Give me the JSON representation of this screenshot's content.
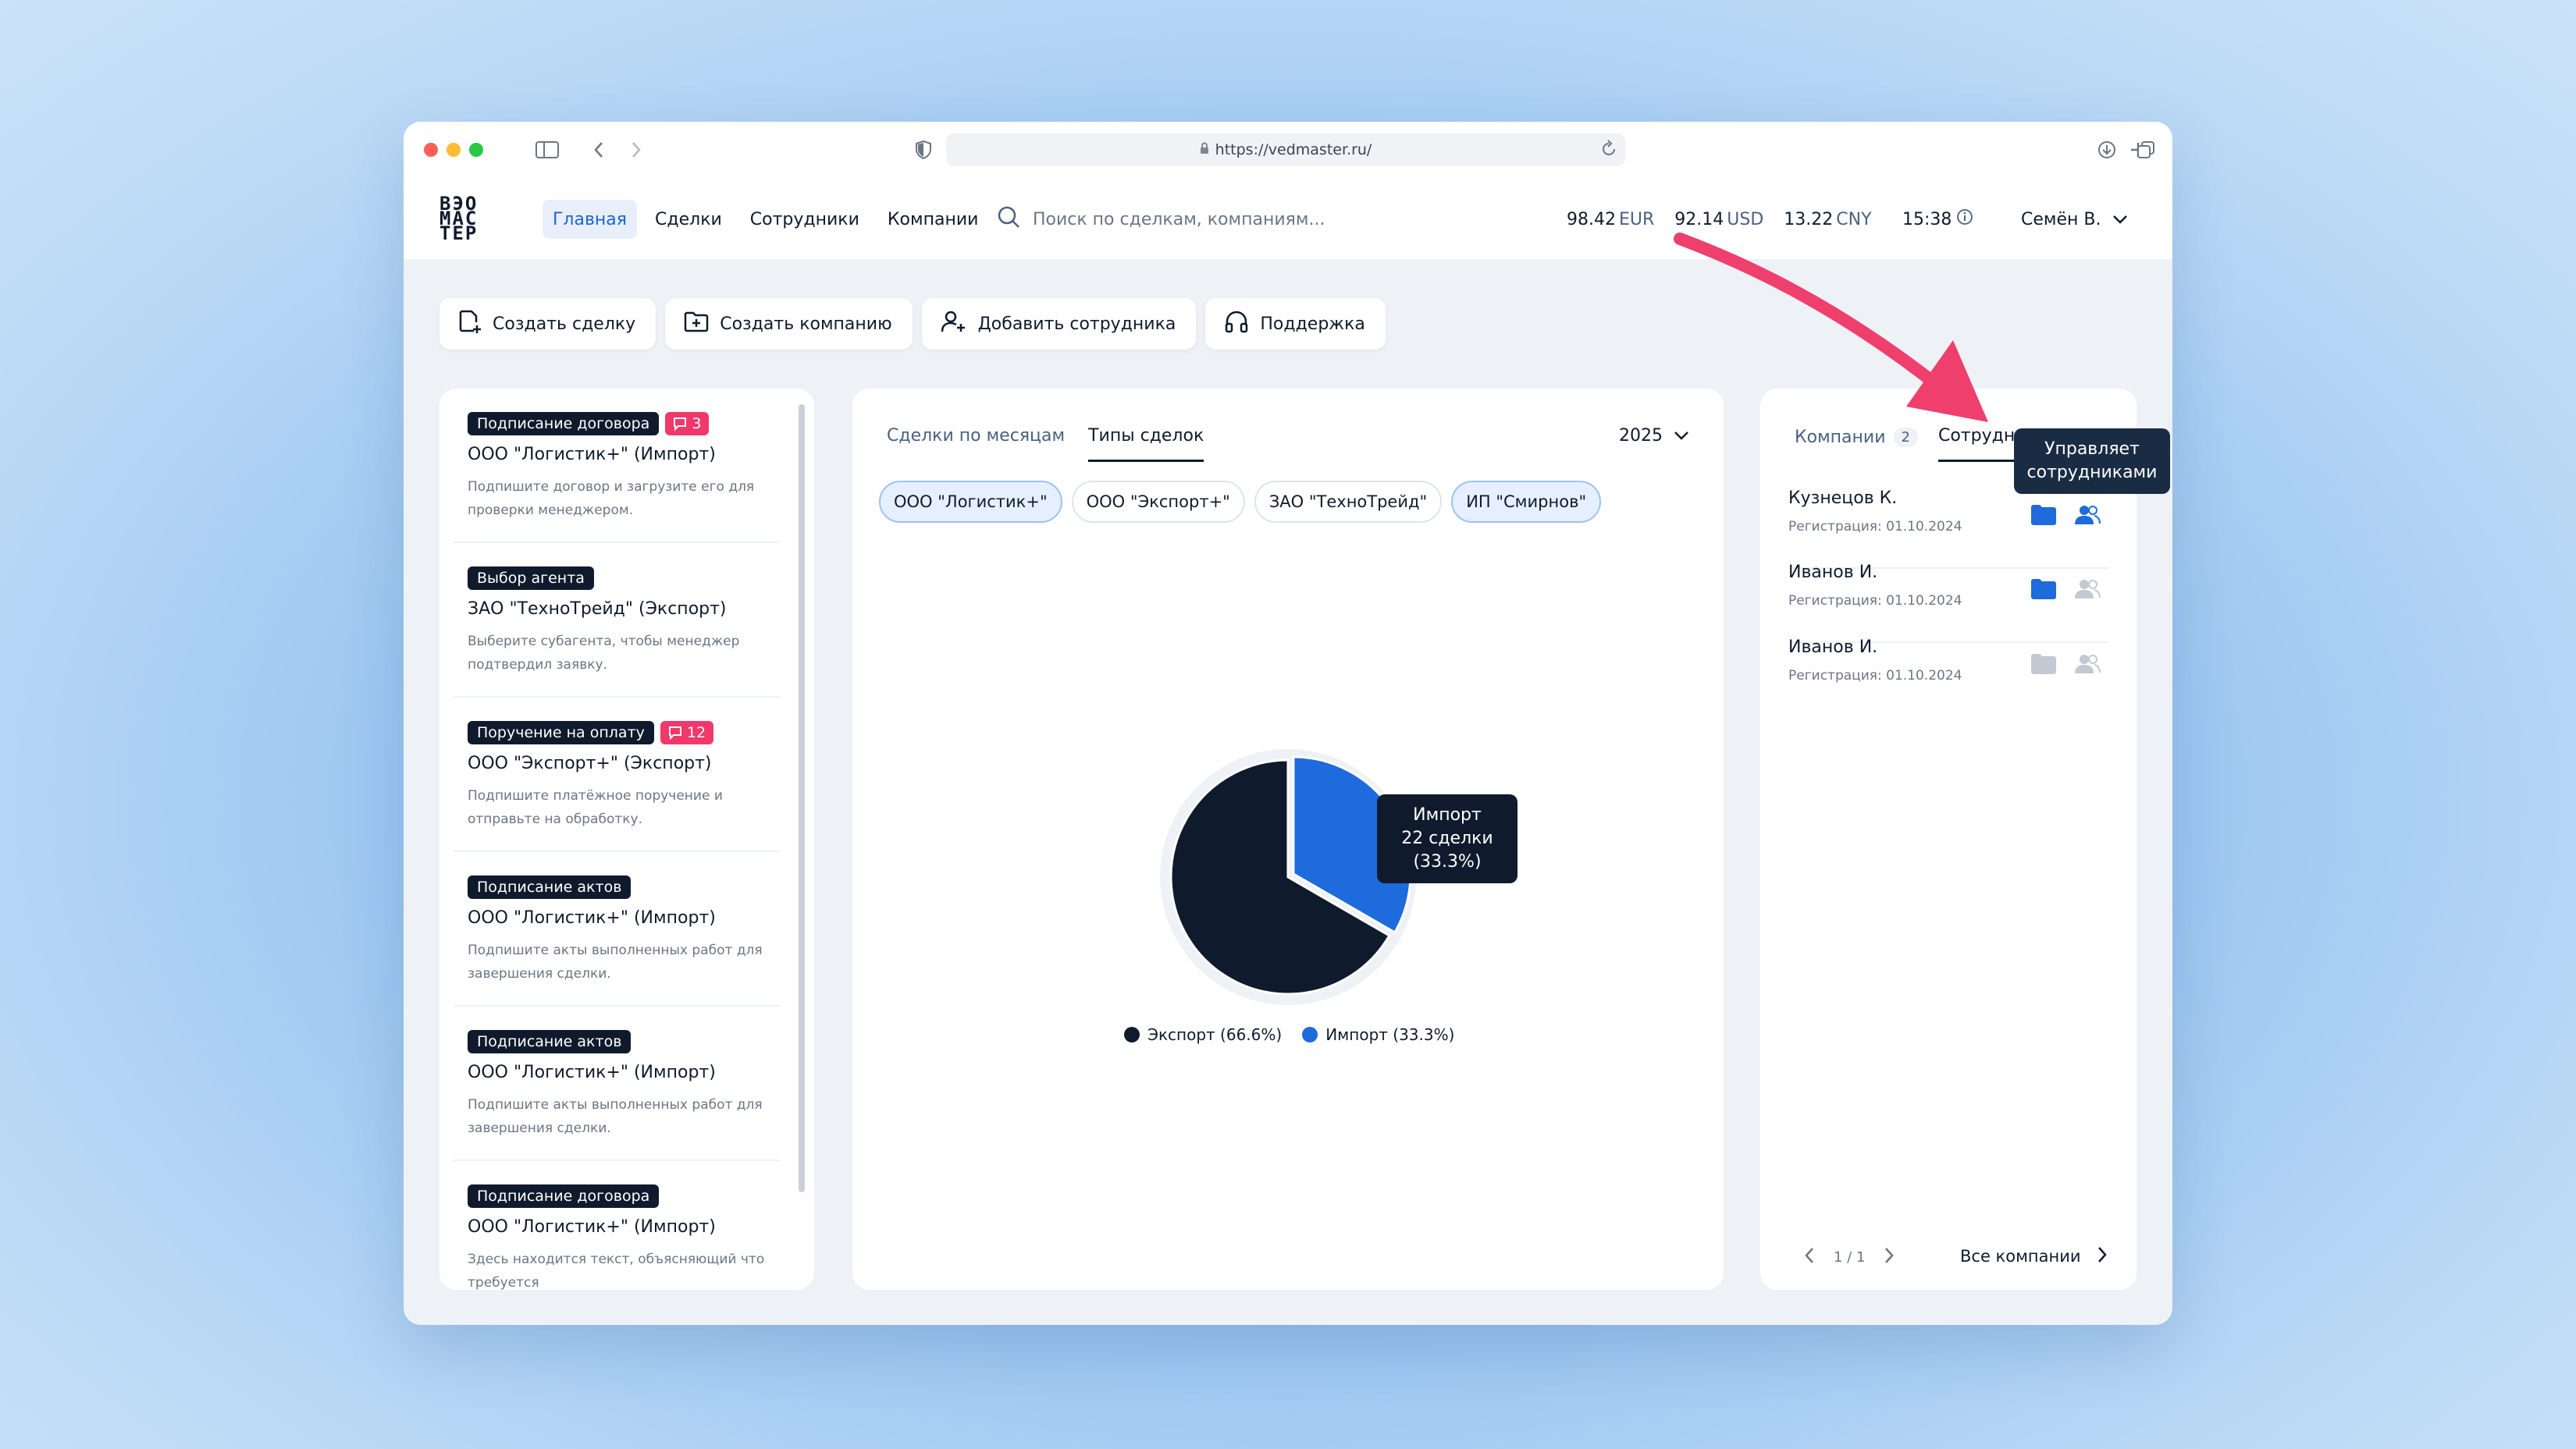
{
  "browser": {
    "url": "https://vedmaster.ru/"
  },
  "logo": {
    "line1": "ВЭО",
    "line2": "МАС",
    "line3": "ТЕР"
  },
  "nav": [
    "Главная",
    "Сделки",
    "Сотрудники",
    "Компании"
  ],
  "search": {
    "placeholder": "Поиск по сделкам, компаниям..."
  },
  "rates": [
    {
      "value": "98.42",
      "currency": "EUR"
    },
    {
      "value": "92.14",
      "currency": "USD"
    },
    {
      "value": "13.22",
      "currency": "CNY"
    }
  ],
  "clock": "15:38",
  "user": "Семён В.",
  "actions": [
    "Создать сделку",
    "Создать компанию",
    "Добавить сотрудника",
    "Поддержка"
  ],
  "tasks": [
    {
      "tag": "Подписание договора",
      "count": "3",
      "title": "ООО \"Логистик+\" (Импорт)",
      "desc": "Подпишите договор и загрузите его для проверки менеджером."
    },
    {
      "tag": "Выбор агента",
      "count": "",
      "title": "ЗАО \"ТехноТрейд\" (Экспорт)",
      "desc": "Выберите субагента, чтобы менеджер подтвердил заявку."
    },
    {
      "tag": "Поручение на оплату",
      "count": "12",
      "title": "ООО \"Экспорт+\" (Экспорт)",
      "desc": "Подпишите платёжное поручение и отправьте на обработку."
    },
    {
      "tag": "Подписание актов",
      "count": "",
      "title": "ООО \"Логистик+\" (Импорт)",
      "desc": "Подпишите акты выполненных работ для завершения сделки."
    },
    {
      "tag": "Подписание актов",
      "count": "",
      "title": "ООО \"Логистик+\" (Импорт)",
      "desc": "Подпишите акты выполненных работ для завершения сделки."
    },
    {
      "tag": "Подписание договора",
      "count": "",
      "title": "ООО \"Логистик+\" (Импорт)",
      "desc": "Здесь находится текст, объясняющий что требуется"
    }
  ],
  "chart_panel": {
    "tabs": [
      "Сделки по месяцам",
      "Типы сделок"
    ],
    "year": "2025",
    "chips": [
      "ООО \"Логистик+\"",
      "ООО \"Экспорт+\"",
      "ЗАО \"ТехноТрейд\"",
      "ИП \"Смирнов\""
    ],
    "tooltip": {
      "line1": "Импорт",
      "line2": "22 сделки",
      "line3": "(33.3%)"
    }
  },
  "chart_data": {
    "type": "pie",
    "categories": [
      "Экспорт",
      "Импорт"
    ],
    "values": [
      66.6,
      33.3
    ],
    "colors": [
      "#0f1b2d",
      "#1d6bdc"
    ],
    "legend": [
      "Экспорт (66.6%)",
      "Импорт (33.3%)"
    ],
    "highlighted": "Импорт"
  },
  "right_panel": {
    "tabs": [
      {
        "label": "Компании",
        "badge": "2"
      },
      {
        "label": "Сотрудни",
        "badge": ""
      }
    ],
    "tooltip": {
      "line1": "Управляет",
      "line2": "сотрудниками"
    },
    "employees": [
      {
        "name": "Кузнецов К.",
        "reg": "Регистрация: 01.10.2024",
        "folder": "active",
        "people": "active"
      },
      {
        "name": "Иванов И.",
        "reg": "Регистрация: 01.10.2024",
        "folder": "active",
        "people": "inactive"
      },
      {
        "name": "Иванов И.",
        "reg": "Регистрация: 01.10.2024",
        "folder": "inactive",
        "people": "inactive"
      }
    ],
    "pager": "1 / 1",
    "all_link": "Все компании"
  },
  "colors": {
    "accent": "#1d63dc",
    "dark": "#0f1b2d",
    "alert": "#f0386b",
    "arrow": "#ef3f6d"
  }
}
